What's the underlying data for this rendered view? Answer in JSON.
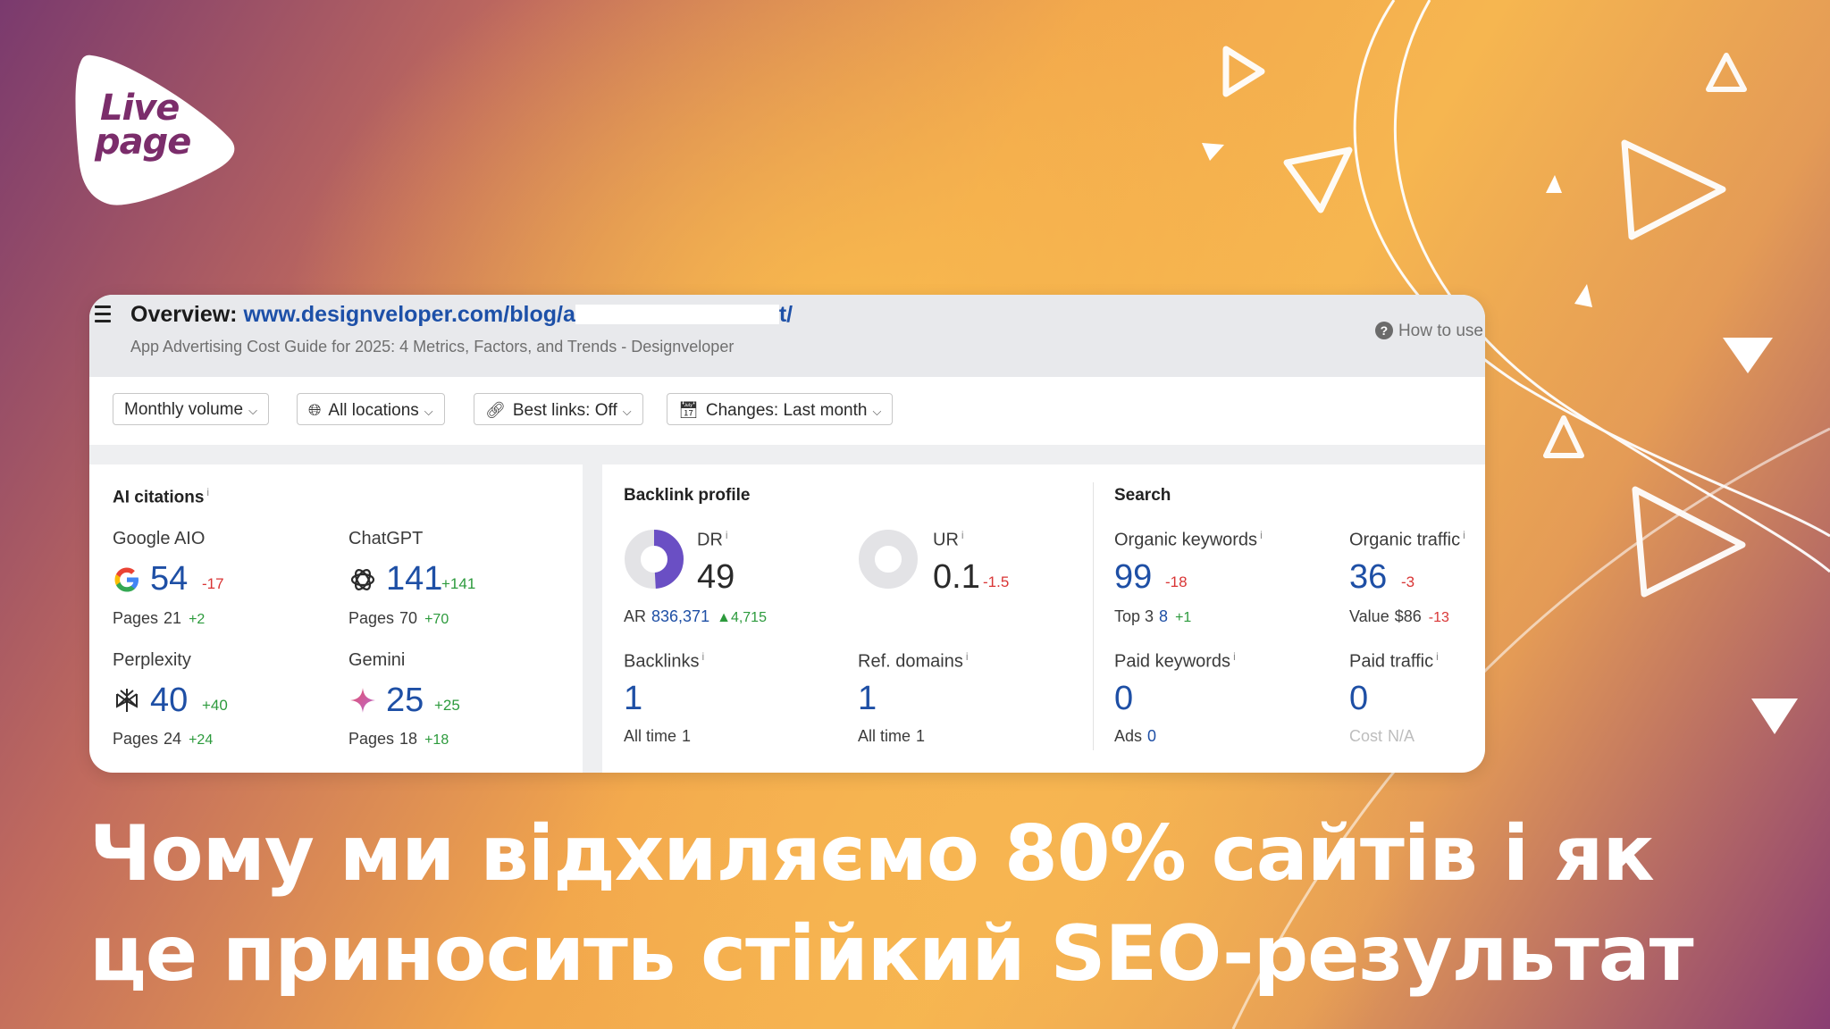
{
  "logo": {
    "line1": "Live",
    "line2": "page"
  },
  "overview": {
    "label": "Overview:",
    "url_start": "www.designveloper.com/blog/a",
    "url_end": "t/",
    "subtitle": "App Advertising Cost Guide for 2025: 4 Metrics, Factors, and Trends - Designveloper",
    "how_to_use": "How to use"
  },
  "filters": {
    "monthly_volume": "Monthly volume",
    "all_locations": "All locations",
    "best_links": "Best links: Off",
    "changes": "Changes: Last month"
  },
  "ai_citations": {
    "title": "AI citations",
    "google": {
      "name": "Google AIO",
      "value": "54",
      "delta": "-17",
      "pages_label": "Pages",
      "pages": "21",
      "pages_delta": "+2"
    },
    "chatgpt": {
      "name": "ChatGPT",
      "value": "141",
      "delta": "+141",
      "pages_label": "Pages",
      "pages": "70",
      "pages_delta": "+70"
    },
    "perplexity": {
      "name": "Perplexity",
      "value": "40",
      "delta": "+40",
      "pages_label": "Pages",
      "pages": "24",
      "pages_delta": "+24"
    },
    "gemini": {
      "name": "Gemini",
      "value": "25",
      "delta": "+25",
      "pages_label": "Pages",
      "pages": "18",
      "pages_delta": "+18"
    }
  },
  "backlink_profile": {
    "title": "Backlink profile",
    "dr": {
      "label": "DR",
      "value": "49",
      "ring_fraction": 0.49
    },
    "ar": {
      "label": "AR",
      "value": "836,371",
      "delta": "4,715"
    },
    "ur": {
      "label": "UR",
      "value": "0.1",
      "delta": "-1.5"
    },
    "backlinks": {
      "label": "Backlinks",
      "value": "1",
      "sub_label": "All time",
      "sub_value": "1"
    },
    "ref_domains": {
      "label": "Ref. domains",
      "value": "1",
      "sub_label": "All time",
      "sub_value": "1"
    }
  },
  "search": {
    "title": "Search",
    "organic_keywords": {
      "label": "Organic keywords",
      "value": "99",
      "delta": "-18",
      "sub_label": "Top 3",
      "sub_value": "8",
      "sub_delta": "+1"
    },
    "organic_traffic": {
      "label": "Organic traffic",
      "value": "36",
      "delta": "-3",
      "sub_label": "Value",
      "sub_value": "$86",
      "sub_delta": "-13"
    },
    "paid_keywords": {
      "label": "Paid keywords",
      "value": "0",
      "sub_label": "Ads",
      "sub_value": "0"
    },
    "paid_traffic": {
      "label": "Paid traffic",
      "value": "0",
      "sub_label": "Cost",
      "sub_value": "N/A"
    }
  },
  "info_marker": "i",
  "headline": {
    "line1": "Чому ми відхиляємо 80% сайтів і як",
    "line2": "це приносить стійкий SEO-результат"
  },
  "colors": {
    "brand_purple": "#7b2d6b",
    "link_blue": "#1e4fa5",
    "negative": "#d93535",
    "positive": "#2c9a3c",
    "dr_ring": "#6a4fc4"
  }
}
